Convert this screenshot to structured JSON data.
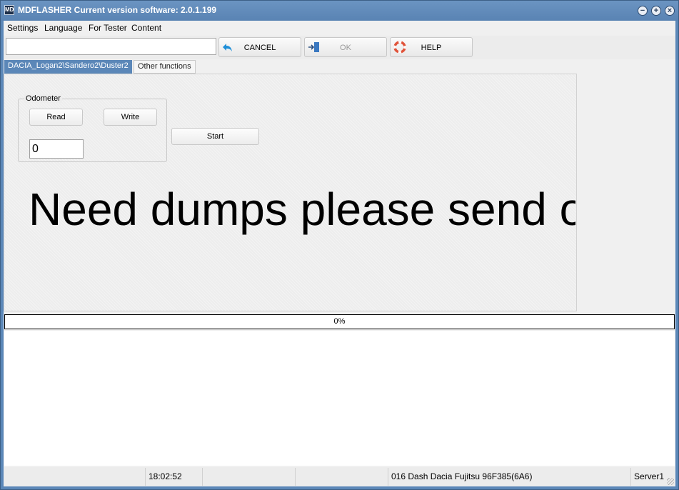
{
  "window": {
    "app_icon_text": "MD",
    "title": "MDFLASHER  Current version software: 2.0.1.199",
    "controls": {
      "minimize": "−",
      "maximize": "+",
      "close": "×"
    }
  },
  "menu": {
    "items": [
      "Settings",
      "Language",
      "For Tester",
      "Content"
    ]
  },
  "toolbar": {
    "combo_value": "",
    "buttons": {
      "cancel": "CANCEL",
      "ok": "OK",
      "help": "HELP"
    }
  },
  "tabs": [
    {
      "label": "DACIA_Logan2\\Sandero2\\Duster2",
      "active": true
    },
    {
      "label": "Other functions",
      "active": false
    }
  ],
  "odometer": {
    "group_title": "Odometer",
    "read_label": "Read",
    "write_label": "Write",
    "value": "0",
    "start_label": "Start"
  },
  "message": "Need dumps please send o",
  "progress": {
    "text": "0%",
    "value": 0
  },
  "status": {
    "time": "18:02:52",
    "device": "016 Dash Dacia Fujitsu 96F385(6A6)",
    "server": "Server1"
  },
  "colors": {
    "accent": "#5b87b8",
    "help_ring": "#e0533a",
    "back_arrow": "#1f8fd8"
  }
}
